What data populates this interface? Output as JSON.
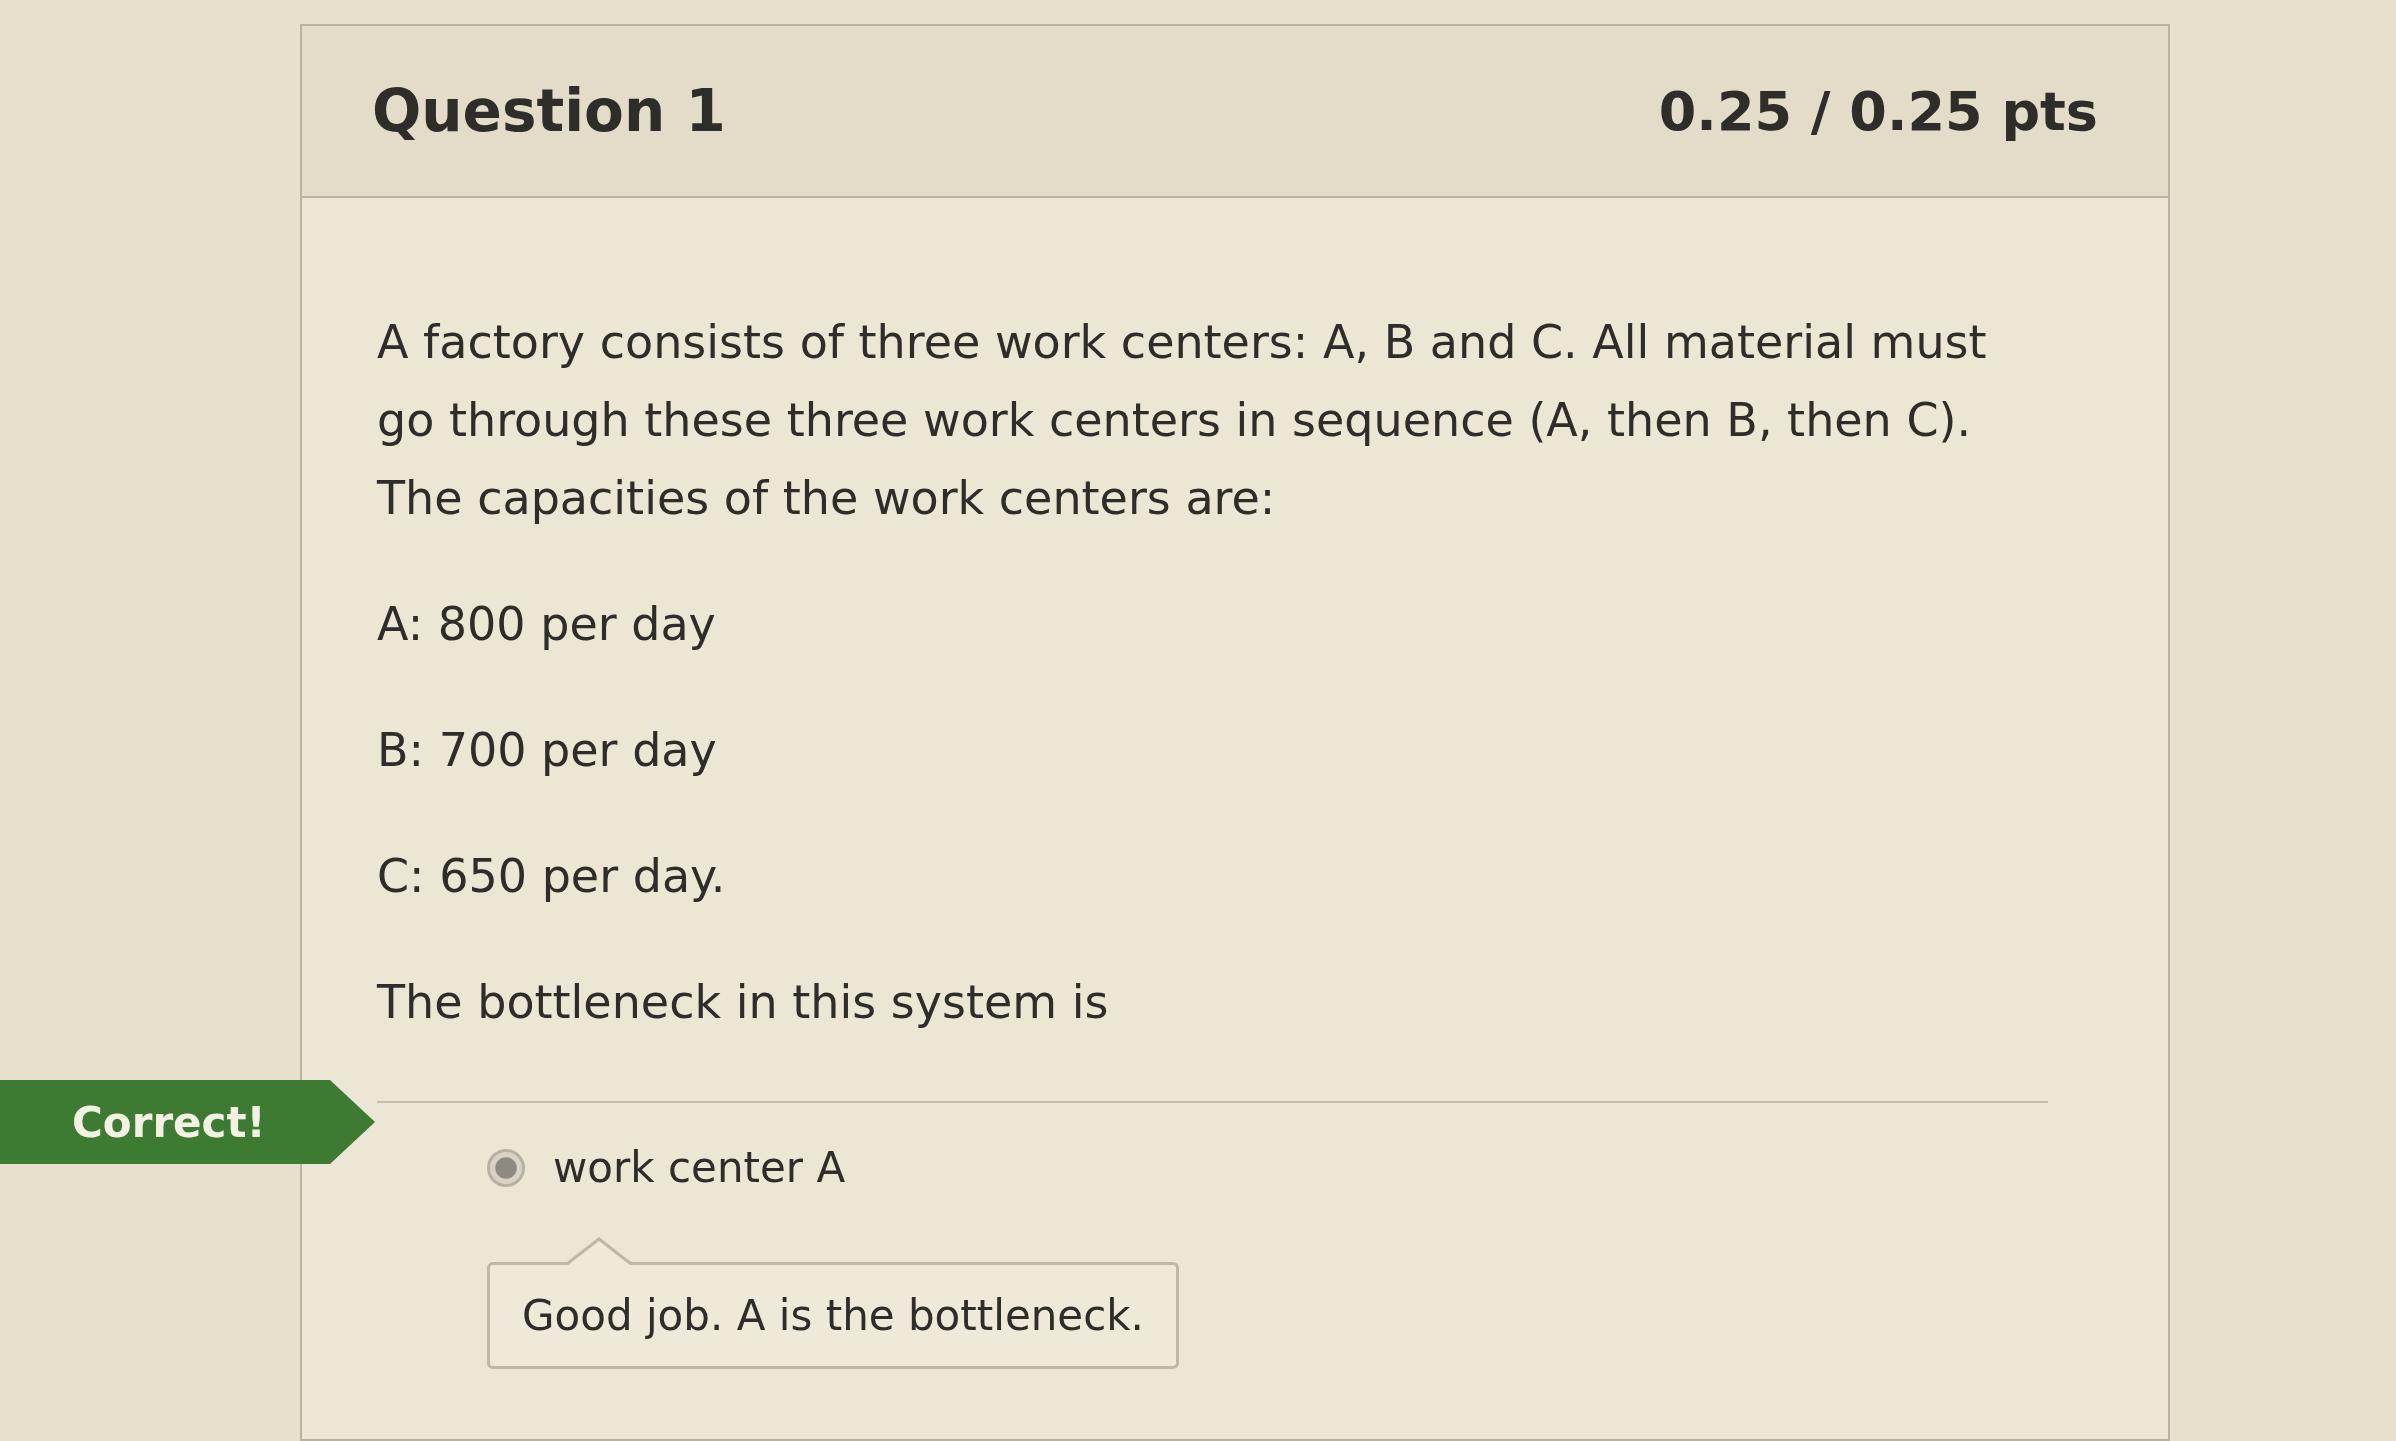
{
  "question": {
    "title": "Question 1",
    "points": "0.25 / 0.25 pts",
    "paragraphs": [
      "A factory consists of three work centers: A, B and C.  All material must go through these three work centers in sequence (A, then B, then C).  The capacities of the work centers are:",
      "A: 800 per day",
      "B: 700 per day",
      "C: 650 per day.",
      "The bottleneck in this system is"
    ],
    "result_flag": "Correct!",
    "answers": [
      {
        "label": "work center A",
        "selected": true
      }
    ],
    "comment": "Good job.  A is the bottleneck."
  }
}
